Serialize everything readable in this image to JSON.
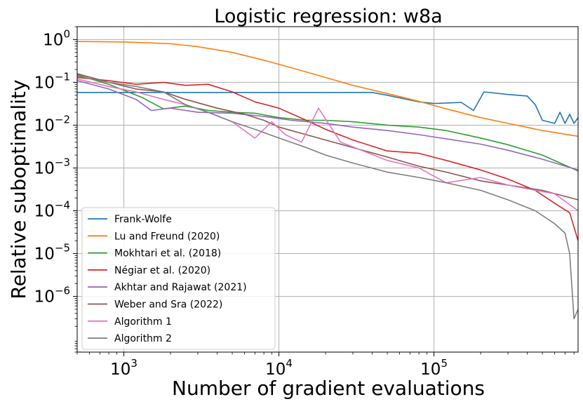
{
  "chart_data": {
    "type": "line",
    "title": "Logistic regression: w8a",
    "xlabel": "Number of gradient evaluations",
    "ylabel": "Relative suboptimality",
    "x_scale": "log",
    "y_scale": "log",
    "xlim": [
      500,
      850000
    ],
    "ylim": [
      5e-08,
      2
    ],
    "x_ticks": [
      {
        "value": 1000,
        "base": "10",
        "exp": "3"
      },
      {
        "value": 10000,
        "base": "10",
        "exp": "4"
      },
      {
        "value": 100000,
        "base": "10",
        "exp": "5"
      }
    ],
    "y_ticks": [
      {
        "value": 1,
        "base": "10",
        "exp": "0"
      },
      {
        "value": 0.1,
        "base": "10",
        "exp": "−1"
      },
      {
        "value": 0.01,
        "base": "10",
        "exp": "−2"
      },
      {
        "value": 0.001,
        "base": "10",
        "exp": "−3"
      },
      {
        "value": 0.0001,
        "base": "10",
        "exp": "−4"
      },
      {
        "value": 1e-05,
        "base": "10",
        "exp": "−5"
      },
      {
        "value": 1e-06,
        "base": "10",
        "exp": "−6"
      }
    ],
    "grid": true,
    "legend_position": "lower-left",
    "series": [
      {
        "name": "Frank-Wolfe",
        "color": "#1f77b4",
        "x": [
          500,
          40000,
          50000,
          80000,
          100000,
          150000,
          180000,
          210000,
          300000,
          400000,
          450000,
          500000,
          600000,
          650000,
          700000,
          750000,
          800000,
          850000
        ],
        "y": [
          0.058,
          0.058,
          0.05,
          0.035,
          0.032,
          0.034,
          0.022,
          0.06,
          0.052,
          0.048,
          0.03,
          0.013,
          0.011,
          0.02,
          0.011,
          0.018,
          0.011,
          0.015
        ]
      },
      {
        "name": "Lu and Freund (2020)",
        "color": "#ff7f0e",
        "x": [
          500,
          1000,
          2000,
          3000,
          5000,
          8000,
          12000,
          20000,
          30000,
          50000,
          80000,
          120000,
          200000,
          300000,
          500000,
          850000
        ],
        "y": [
          0.9,
          0.88,
          0.8,
          0.68,
          0.5,
          0.33,
          0.22,
          0.13,
          0.085,
          0.055,
          0.036,
          0.024,
          0.015,
          0.011,
          0.0075,
          0.0055
        ]
      },
      {
        "name": "Mokhtari et al. (2018)",
        "color": "#2ca02c",
        "x": [
          500,
          800,
          1300,
          1800,
          2500,
          3500,
          5000,
          7000,
          10000,
          15000,
          20000,
          30000,
          50000,
          80000,
          120000,
          200000,
          300000,
          500000,
          850000
        ],
        "y": [
          0.15,
          0.09,
          0.045,
          0.024,
          0.028,
          0.022,
          0.02,
          0.019,
          0.015,
          0.013,
          0.013,
          0.012,
          0.01,
          0.009,
          0.0075,
          0.005,
          0.0035,
          0.002,
          0.00085
        ]
      },
      {
        "name": "Négiar et al. (2020)",
        "color": "#d62728",
        "x": [
          500,
          800,
          1200,
          1800,
          2500,
          3500,
          5000,
          7000,
          10000,
          15000,
          20000,
          30000,
          50000,
          80000,
          120000,
          200000,
          300000,
          450000,
          600000,
          750000,
          850000
        ],
        "y": [
          0.13,
          0.11,
          0.09,
          0.1,
          0.085,
          0.09,
          0.06,
          0.035,
          0.025,
          0.013,
          0.008,
          0.0045,
          0.0025,
          0.0022,
          0.0015,
          0.0009,
          0.00055,
          0.0003,
          0.00015,
          9e-05,
          2e-05
        ]
      },
      {
        "name": "Akhtar and Rajawat (2021)",
        "color": "#9467bd",
        "x": [
          500,
          800,
          1200,
          1500,
          2000,
          3000,
          5000,
          8000,
          12000,
          20000,
          30000,
          50000,
          80000,
          120000,
          200000,
          300000,
          500000,
          850000
        ],
        "y": [
          0.11,
          0.07,
          0.04,
          0.022,
          0.025,
          0.02,
          0.019,
          0.016,
          0.013,
          0.011,
          0.009,
          0.0075,
          0.006,
          0.0048,
          0.0036,
          0.0026,
          0.0016,
          0.0009
        ]
      },
      {
        "name": "Weber and Sra (2022)",
        "color": "#8c564b",
        "x": [
          500,
          800,
          1200,
          1800,
          2500,
          4000,
          6000,
          8000,
          10000,
          15000,
          20000,
          30000,
          50000,
          80000,
          120000,
          200000,
          300000,
          500000,
          850000
        ],
        "y": [
          0.16,
          0.1,
          0.07,
          0.06,
          0.04,
          0.025,
          0.018,
          0.013,
          0.009,
          0.006,
          0.0045,
          0.003,
          0.0018,
          0.0011,
          0.0008,
          0.0005,
          0.0004,
          0.0003,
          0.00018
        ]
      },
      {
        "name": "Algorithm 1",
        "color": "#e377c2",
        "x": [
          500,
          800,
          1200,
          1800,
          2500,
          3500,
          5000,
          7000,
          9000,
          11000,
          14000,
          18000,
          25000,
          35000,
          50000,
          80000,
          120000,
          200000,
          300000,
          450000,
          600000,
          850000
        ],
        "y": [
          0.12,
          0.08,
          0.06,
          0.04,
          0.03,
          0.02,
          0.012,
          0.005,
          0.012,
          0.006,
          0.004,
          0.025,
          0.004,
          0.0025,
          0.0015,
          0.001,
          0.00045,
          0.0006,
          0.0004,
          0.0003,
          0.00025,
          0.0001
        ]
      },
      {
        "name": "Algorithm 2",
        "color": "#7f7f7f",
        "x": [
          500,
          800,
          1200,
          1800,
          2500,
          3500,
          5000,
          7000,
          10000,
          15000,
          20000,
          30000,
          50000,
          80000,
          120000,
          200000,
          300000,
          450000,
          600000,
          700000,
          750000,
          800000,
          850000
        ],
        "y": [
          0.14,
          0.1,
          0.08,
          0.06,
          0.03,
          0.02,
          0.012,
          0.008,
          0.005,
          0.003,
          0.002,
          0.0013,
          0.0008,
          0.0006,
          0.00045,
          0.0003,
          0.00018,
          0.0001,
          5e-05,
          3e-05,
          1e-05,
          3e-07,
          5e-07
        ]
      }
    ]
  }
}
